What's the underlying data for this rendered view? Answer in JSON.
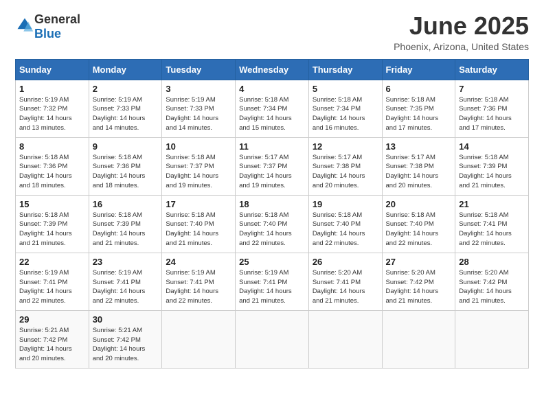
{
  "header": {
    "logo_general": "General",
    "logo_blue": "Blue",
    "title": "June 2025",
    "subtitle": "Phoenix, Arizona, United States"
  },
  "calendar": {
    "weekdays": [
      "Sunday",
      "Monday",
      "Tuesday",
      "Wednesday",
      "Thursday",
      "Friday",
      "Saturday"
    ],
    "weeks": [
      [
        {
          "day": "1",
          "sunrise": "5:19 AM",
          "sunset": "7:32 PM",
          "daylight": "14 hours and 13 minutes."
        },
        {
          "day": "2",
          "sunrise": "5:19 AM",
          "sunset": "7:33 PM",
          "daylight": "14 hours and 14 minutes."
        },
        {
          "day": "3",
          "sunrise": "5:19 AM",
          "sunset": "7:33 PM",
          "daylight": "14 hours and 14 minutes."
        },
        {
          "day": "4",
          "sunrise": "5:18 AM",
          "sunset": "7:34 PM",
          "daylight": "14 hours and 15 minutes."
        },
        {
          "day": "5",
          "sunrise": "5:18 AM",
          "sunset": "7:34 PM",
          "daylight": "14 hours and 16 minutes."
        },
        {
          "day": "6",
          "sunrise": "5:18 AM",
          "sunset": "7:35 PM",
          "daylight": "14 hours and 17 minutes."
        },
        {
          "day": "7",
          "sunrise": "5:18 AM",
          "sunset": "7:36 PM",
          "daylight": "14 hours and 17 minutes."
        }
      ],
      [
        {
          "day": "8",
          "sunrise": "5:18 AM",
          "sunset": "7:36 PM",
          "daylight": "14 hours and 18 minutes."
        },
        {
          "day": "9",
          "sunrise": "5:18 AM",
          "sunset": "7:36 PM",
          "daylight": "14 hours and 18 minutes."
        },
        {
          "day": "10",
          "sunrise": "5:18 AM",
          "sunset": "7:37 PM",
          "daylight": "14 hours and 19 minutes."
        },
        {
          "day": "11",
          "sunrise": "5:17 AM",
          "sunset": "7:37 PM",
          "daylight": "14 hours and 19 minutes."
        },
        {
          "day": "12",
          "sunrise": "5:17 AM",
          "sunset": "7:38 PM",
          "daylight": "14 hours and 20 minutes."
        },
        {
          "day": "13",
          "sunrise": "5:17 AM",
          "sunset": "7:38 PM",
          "daylight": "14 hours and 20 minutes."
        },
        {
          "day": "14",
          "sunrise": "5:18 AM",
          "sunset": "7:39 PM",
          "daylight": "14 hours and 21 minutes."
        }
      ],
      [
        {
          "day": "15",
          "sunrise": "5:18 AM",
          "sunset": "7:39 PM",
          "daylight": "14 hours and 21 minutes."
        },
        {
          "day": "16",
          "sunrise": "5:18 AM",
          "sunset": "7:39 PM",
          "daylight": "14 hours and 21 minutes."
        },
        {
          "day": "17",
          "sunrise": "5:18 AM",
          "sunset": "7:40 PM",
          "daylight": "14 hours and 21 minutes."
        },
        {
          "day": "18",
          "sunrise": "5:18 AM",
          "sunset": "7:40 PM",
          "daylight": "14 hours and 22 minutes."
        },
        {
          "day": "19",
          "sunrise": "5:18 AM",
          "sunset": "7:40 PM",
          "daylight": "14 hours and 22 minutes."
        },
        {
          "day": "20",
          "sunrise": "5:18 AM",
          "sunset": "7:40 PM",
          "daylight": "14 hours and 22 minutes."
        },
        {
          "day": "21",
          "sunrise": "5:18 AM",
          "sunset": "7:41 PM",
          "daylight": "14 hours and 22 minutes."
        }
      ],
      [
        {
          "day": "22",
          "sunrise": "5:19 AM",
          "sunset": "7:41 PM",
          "daylight": "14 hours and 22 minutes."
        },
        {
          "day": "23",
          "sunrise": "5:19 AM",
          "sunset": "7:41 PM",
          "daylight": "14 hours and 22 minutes."
        },
        {
          "day": "24",
          "sunrise": "5:19 AM",
          "sunset": "7:41 PM",
          "daylight": "14 hours and 22 minutes."
        },
        {
          "day": "25",
          "sunrise": "5:19 AM",
          "sunset": "7:41 PM",
          "daylight": "14 hours and 21 minutes."
        },
        {
          "day": "26",
          "sunrise": "5:20 AM",
          "sunset": "7:41 PM",
          "daylight": "14 hours and 21 minutes."
        },
        {
          "day": "27",
          "sunrise": "5:20 AM",
          "sunset": "7:42 PM",
          "daylight": "14 hours and 21 minutes."
        },
        {
          "day": "28",
          "sunrise": "5:20 AM",
          "sunset": "7:42 PM",
          "daylight": "14 hours and 21 minutes."
        }
      ],
      [
        {
          "day": "29",
          "sunrise": "5:21 AM",
          "sunset": "7:42 PM",
          "daylight": "14 hours and 20 minutes."
        },
        {
          "day": "30",
          "sunrise": "5:21 AM",
          "sunset": "7:42 PM",
          "daylight": "14 hours and 20 minutes."
        },
        null,
        null,
        null,
        null,
        null
      ]
    ]
  }
}
